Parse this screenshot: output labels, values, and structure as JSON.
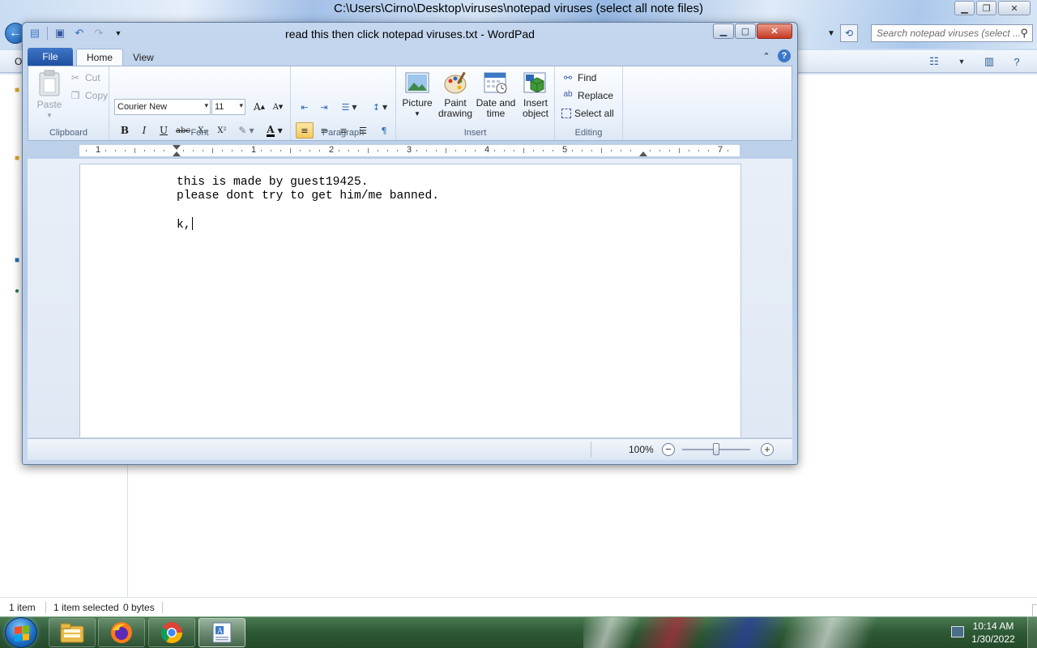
{
  "explorer": {
    "title": "C:\\Users\\Cirno\\Desktop\\viruses\\notepad viruses (select all note files)",
    "search_placeholder": "Search notepad viruses (select ...",
    "command_label": "O",
    "status": {
      "items": "1 item",
      "selected": "1 item selected",
      "size": "0 bytes"
    }
  },
  "wordpad": {
    "title": "read this then click notepad viruses.txt - WordPad",
    "tabs": {
      "file": "File",
      "home": "Home",
      "view": "View"
    },
    "clipboard": {
      "paste": "Paste",
      "cut": "Cut",
      "copy": "Copy",
      "label": "Clipboard"
    },
    "font": {
      "family": "Courier New",
      "size": "11",
      "label": "Font",
      "bold": "B",
      "italic": "I",
      "underline": "U",
      "strike": "abc",
      "sub": "X₂",
      "sup": "X²",
      "color": "A"
    },
    "paragraph": {
      "label": "Paragraph"
    },
    "insert": {
      "picture": "Picture",
      "paint_drawing": "Paint drawing",
      "date_time": "Date and time",
      "insert_object": "Insert object",
      "label": "Insert"
    },
    "editing": {
      "find": "Find",
      "replace": "Replace",
      "select_all": "Select all",
      "label": "Editing"
    },
    "ruler": [
      "1",
      "1",
      "2",
      "3",
      "4",
      "5",
      "7"
    ],
    "document": {
      "lines": [
        "this is made by guest19425.",
        "please dont try to get him/me banned.",
        "k,"
      ]
    },
    "zoom": {
      "label": "100%",
      "level_percent": 100
    }
  },
  "taskbar": {
    "time": "10:14 AM",
    "date": "1/30/2022",
    "apps": [
      "file-explorer",
      "firefox",
      "chrome",
      "wordpad"
    ]
  },
  "colors": {
    "file_tab": "#1e4f9f",
    "close_button": "#c73a22",
    "taskbar": "#2f5a36"
  }
}
